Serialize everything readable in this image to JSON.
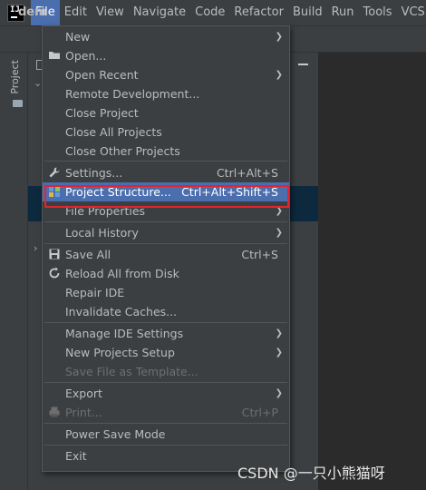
{
  "menubar": {
    "logo_text": "IJ",
    "items": [
      {
        "label": "File",
        "active": true
      },
      {
        "label": "Edit"
      },
      {
        "label": "View"
      },
      {
        "label": "Navigate"
      },
      {
        "label": "Code"
      },
      {
        "label": "Refactor"
      },
      {
        "label": "Build"
      },
      {
        "label": "Run"
      },
      {
        "label": "Tools"
      },
      {
        "label": "VCS"
      }
    ]
  },
  "toolbar": {
    "project_crumb": "dem"
  },
  "side": {
    "project_tab": "Project"
  },
  "file_menu": {
    "items": [
      {
        "label": "New",
        "submenu": true
      },
      {
        "label": "Open...",
        "icon": "folder-icon"
      },
      {
        "label": "Open Recent",
        "submenu": true
      },
      {
        "label": "Remote Development..."
      },
      {
        "label": "Close Project"
      },
      {
        "label": "Close All Projects"
      },
      {
        "label": "Close Other Projects"
      },
      {
        "label": "Settings...",
        "shortcut": "Ctrl+Alt+S",
        "icon": "wrench-icon"
      },
      {
        "label": "Project Structure...",
        "shortcut": "Ctrl+Alt+Shift+S",
        "icon": "project-structure-icon",
        "selected": true
      },
      {
        "label": "File Properties",
        "submenu": true
      },
      {
        "label": "Local History",
        "submenu": true
      },
      {
        "label": "Save All",
        "shortcut": "Ctrl+S",
        "icon": "save-icon"
      },
      {
        "label": "Reload All from Disk",
        "icon": "reload-icon"
      },
      {
        "label": "Repair IDE"
      },
      {
        "label": "Invalidate Caches..."
      },
      {
        "label": "Manage IDE Settings",
        "submenu": true
      },
      {
        "label": "New Projects Setup",
        "submenu": true
      },
      {
        "label": "Save File as Template...",
        "disabled": true
      },
      {
        "label": "Export",
        "submenu": true
      },
      {
        "label": "Print...",
        "shortcut": "Ctrl+P",
        "icon": "print-icon",
        "disabled": true
      },
      {
        "label": "Power Save Mode"
      },
      {
        "label": "Exit"
      }
    ]
  },
  "watermark": "CSDN @一只小熊猫呀",
  "colors": {
    "menu_bg": "#3c3f41",
    "selection": "#4b6eaf",
    "annotation_box": "#e0262e",
    "editor_bg": "#2b2b2b"
  }
}
